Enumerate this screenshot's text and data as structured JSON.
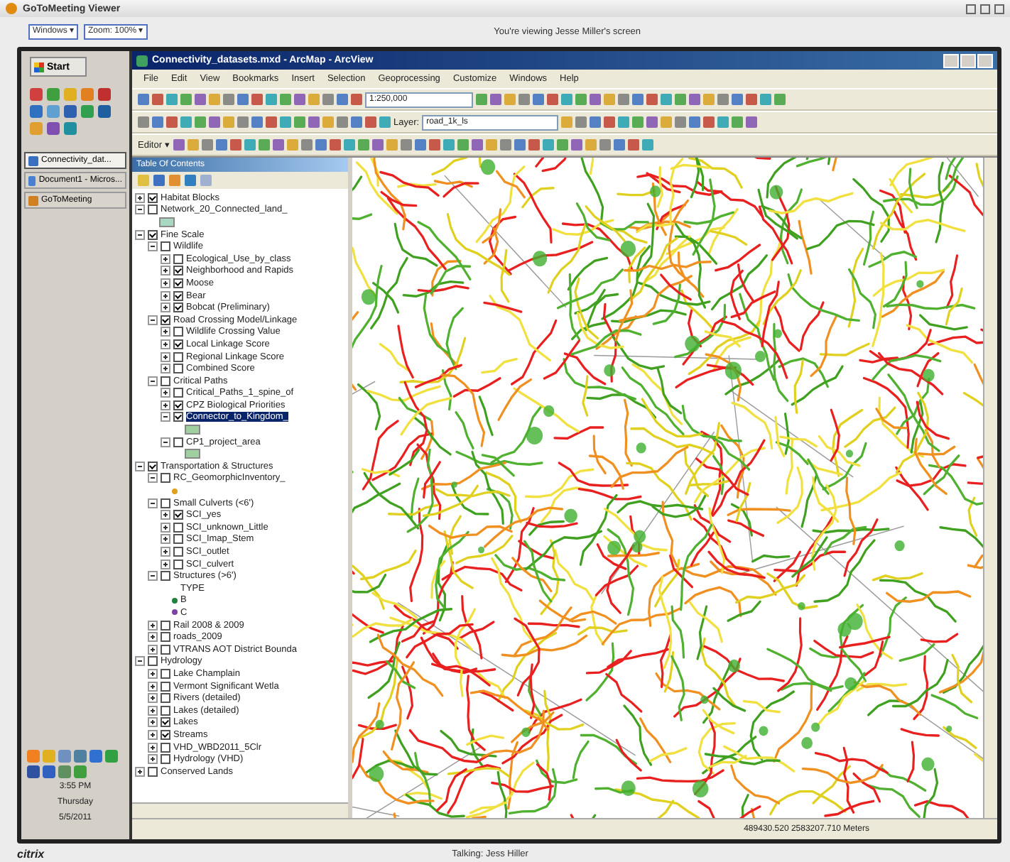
{
  "viewer": {
    "title": "GoToMeeting Viewer",
    "menus": [
      "Windows ▾",
      "Zoom: 100% ▾"
    ],
    "status": "You're viewing Jesse Miller's screen"
  },
  "desktop": {
    "start": "Start",
    "tasks": [
      {
        "label": "Connectivity_dat...",
        "selected": true
      },
      {
        "label": "Document1 - Micros...",
        "selected": false
      },
      {
        "label": "GoToMeeting",
        "selected": false
      }
    ],
    "clock": [
      "3:55 PM",
      "Thursday",
      "5/5/2011"
    ]
  },
  "arcmap": {
    "title": "Connectivity_datasets.mxd - ArcMap - ArcView",
    "menu": [
      "File",
      "Edit",
      "View",
      "Bookmarks",
      "Insert",
      "Selection",
      "Geoprocessing",
      "Customize",
      "Windows",
      "Help"
    ],
    "scale": "1:250,000",
    "tool_labels": [
      "Editor ▾",
      "Layer:"
    ],
    "layer": "road_1k_ls",
    "toc_title": "Table Of Contents",
    "layers": [
      {
        "label": "Habitat Blocks",
        "expanded": false,
        "checked": true
      },
      {
        "label": "Network_20_Connected_land_",
        "expanded": true,
        "checked": false,
        "children": [
          {
            "kind": "swatch",
            "color": "#a8d8c0"
          }
        ]
      },
      {
        "label": "Fine Scale",
        "expanded": true,
        "checked": true,
        "children": [
          {
            "label": "Wildlife",
            "expanded": true,
            "checked": false,
            "children": [
              {
                "label": "Ecological_Use_by_class",
                "expanded": false,
                "checked": false
              },
              {
                "label": "Neighborhood and Rapids",
                "expanded": false,
                "checked": true
              },
              {
                "label": "Moose",
                "expanded": false,
                "checked": true
              },
              {
                "label": "Bear",
                "expanded": false,
                "checked": true
              },
              {
                "label": "Bobcat (Preliminary)",
                "expanded": false,
                "checked": true
              }
            ]
          },
          {
            "label": "Road Crossing Model/Linkage",
            "expanded": true,
            "checked": true,
            "children": [
              {
                "label": "Wildlife Crossing Value",
                "expanded": false,
                "checked": false
              },
              {
                "label": "Local Linkage Score",
                "expanded": false,
                "checked": true
              },
              {
                "label": "Regional Linkage Score",
                "expanded": false,
                "checked": false
              },
              {
                "label": "Combined Score",
                "expanded": false,
                "checked": false
              }
            ]
          },
          {
            "label": "Critical Paths",
            "expanded": true,
            "checked": false,
            "children": [
              {
                "label": "Critical_Paths_1_spine_of",
                "expanded": false,
                "checked": false
              },
              {
                "label": "CPZ Biological Priorities",
                "expanded": false,
                "checked": true
              },
              {
                "label": "Connector_to_Kingdom_",
                "expanded": true,
                "checked": true,
                "selected": true,
                "children": [
                  {
                    "kind": "swatch",
                    "color": "#a0d0a0"
                  }
                ]
              },
              {
                "label": "CP1_project_area",
                "expanded": true,
                "checked": false,
                "children": [
                  {
                    "kind": "swatch",
                    "color": "#a0d0a0"
                  }
                ]
              }
            ]
          }
        ]
      },
      {
        "label": "Transportation & Structures",
        "expanded": true,
        "checked": true,
        "children": [
          {
            "label": "RC_GeomorphicInventory_",
            "expanded": true,
            "checked": false,
            "children": [
              {
                "kind": "point",
                "color": "#e0a020"
              }
            ]
          },
          {
            "label": "Small Culverts (<6')",
            "expanded": true,
            "checked": false,
            "children": [
              {
                "label": "SCI_yes",
                "expanded": false,
                "checked": true
              },
              {
                "label": "SCI_unknown_Little",
                "expanded": false,
                "checked": false
              },
              {
                "label": "SCI_Imap_Stem",
                "expanded": false,
                "checked": false
              },
              {
                "label": "SCI_outlet",
                "expanded": false,
                "checked": false
              },
              {
                "label": "SCI_culvert",
                "expanded": false,
                "checked": false
              }
            ]
          },
          {
            "label": "Structures (>6')",
            "expanded": true,
            "checked": false,
            "children": [
              {
                "kind": "heading",
                "label": "TYPE"
              },
              {
                "kind": "point",
                "color": "#208040",
                "label": "B"
              },
              {
                "kind": "point",
                "color": "#8040a0",
                "label": "C"
              }
            ]
          },
          {
            "label": "Rail 2008 & 2009",
            "expanded": false,
            "checked": false
          },
          {
            "label": "roads_2009",
            "expanded": false,
            "checked": false
          },
          {
            "label": "VTRANS AOT District Bounda",
            "expanded": false,
            "checked": false
          }
        ]
      },
      {
        "label": "Hydrology",
        "expanded": true,
        "checked": false,
        "children": [
          {
            "label": "Lake Champlain",
            "expanded": false,
            "checked": false
          },
          {
            "label": "Vermont Significant Wetla",
            "expanded": false,
            "checked": false
          },
          {
            "label": "Rivers (detailed)",
            "expanded": false,
            "checked": false
          },
          {
            "label": "Lakes (detailed)",
            "expanded": false,
            "checked": false
          },
          {
            "label": "Lakes",
            "expanded": false,
            "checked": true
          },
          {
            "label": "Streams",
            "expanded": false,
            "checked": true
          },
          {
            "label": "VHD_WBD2011_5Clr",
            "expanded": false,
            "checked": false
          },
          {
            "label": "Hydrology (VHD)",
            "expanded": false,
            "checked": false
          }
        ]
      },
      {
        "label": "Conserved Lands",
        "expanded": false,
        "checked": false
      }
    ],
    "coordinates": "489430.520  2583207.710 Meters"
  },
  "footer": {
    "logo": "citrix",
    "talking": "Talking: Jess Hiller"
  }
}
